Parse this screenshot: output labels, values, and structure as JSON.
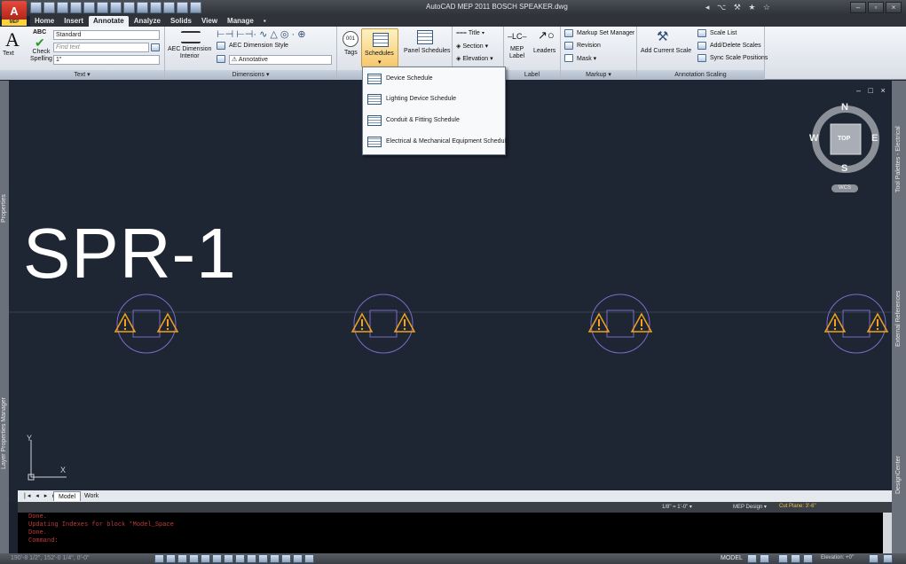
{
  "window": {
    "title": "AutoCAD MEP 2011   BOSCH SPEAKER.dwg",
    "app_button_label": "A",
    "app_button_badge": "MEP",
    "help_cluster": "◂ ⌥ ⚒ ★ ☆"
  },
  "ribbon_tabs": [
    "Home",
    "Insert",
    "Annotate",
    "Analyze",
    "Solids",
    "View",
    "Manage",
    "▪"
  ],
  "ribbon_active_tab": "Annotate",
  "ribbon": {
    "text_panel": {
      "title": "Text ▾",
      "text_btn": "Text",
      "check_spelling": "Check\nSpelling",
      "abc": "ABC",
      "style_combo": "Standard",
      "find_placeholder": "Find text",
      "height_combo": "1\""
    },
    "dimensions_panel": {
      "title": "Dimensions ▾",
      "aec_dim_interior": "AEC Dimension\nInterior",
      "aec_dim_style": "AEC Dimension Style",
      "annotative": "Annotative"
    },
    "tags_btn": "Tags",
    "schedules_btn": "Schedules",
    "panel_schedules_btn": "Panel Schedules",
    "callouts": {
      "title": "Title",
      "section": "Section",
      "elevation": "Elevation"
    },
    "label_panel": {
      "title": "Label",
      "mep_label": "MEP\nLabel",
      "leaders": "Leaders"
    },
    "markup_panel": {
      "title": "Markup ▾",
      "markup_set_manager": "Markup Set Manager",
      "revision": "Revision",
      "mask": "Mask ▾"
    },
    "annotation_scaling_panel": {
      "title": "Annotation Scaling",
      "add_current_scale": "Add Current Scale",
      "scale_list": "Scale List",
      "add_delete_scales": "Add/Delete Scales",
      "sync_scale_positions": "Sync Scale Positions"
    }
  },
  "schedules_menu": [
    "Device Schedule",
    "Lighting Device Schedule",
    "Conduit & Fitting Schedule",
    "Electrical & Mechanical Equipment Schedule"
  ],
  "palettes": {
    "properties": "Properties",
    "layer_properties_manager": "Layer Properties Manager",
    "tool_palettes": "Tool Palettes - Electrical",
    "external_references": "External References",
    "design_center": "DesignCenter"
  },
  "drawing": {
    "tag_text": "SPR-1",
    "speaker_count": 4,
    "ucs_y": "Y",
    "ucs_x": "X"
  },
  "viewcube": {
    "north": "N",
    "south": "S",
    "east": "E",
    "west": "W",
    "face": "TOP",
    "wcs": "WCS"
  },
  "viewport_controls": "– □ ×",
  "layout_tabs": [
    "Model",
    "Work"
  ],
  "layout_active": "Model",
  "drawing_status": {
    "scale": "1/8\" = 1'-0\" ▾",
    "display_config": "MEP Design ▾",
    "cut_plane": "Cut Plane: 3'-6\""
  },
  "command_lines": [
    "Done.",
    "Updating Indexes for block *Model_Space",
    "Done.",
    "Command:"
  ],
  "status": {
    "coords": "190'-8 1/2\", 152'-0 1/4\", 0'-0\"",
    "model": "MODEL",
    "elevation": "Elevation: +0\""
  },
  "colors": {
    "canvas": "#1e2533",
    "speaker_circle": "#7b6cc9",
    "warning": "#f2a21b",
    "command_text": "#c03a3a"
  }
}
